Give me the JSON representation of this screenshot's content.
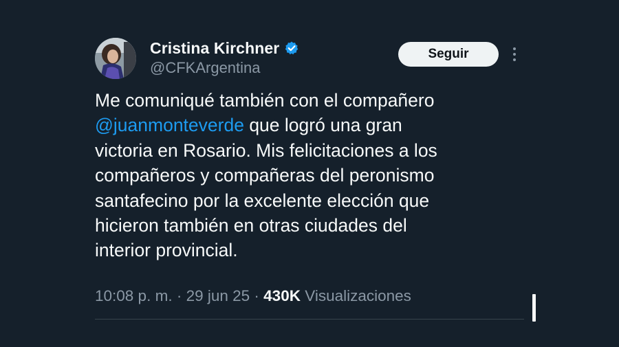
{
  "author": {
    "display_name": "Cristina Kirchner",
    "handle": "@CFKArgentina",
    "verified_icon": "verified-badge-icon",
    "avatar_icon": "profile-photo"
  },
  "actions": {
    "follow_label": "Seguir",
    "more_icon": "more-options-icon"
  },
  "tweet": {
    "line1": "Me comuniqué también con el compañero",
    "mention": "@juanmonteverde",
    "line2_rest": " que logró una gran",
    "line3": "victoria en Rosario. Mis felicitaciones a los",
    "line4": "compañeros y compañeras del peronismo",
    "line5": "santafecino por la excelente elección que",
    "line6": "hicieron también en otras ciudades del",
    "line7": "interior provincial."
  },
  "meta": {
    "time": "10:08 p. m.",
    "separator": " · ",
    "date": "29 jun 25",
    "views_count": "430K",
    "views_label": "Visualizaciones"
  },
  "colors": {
    "background": "#15202b",
    "text": "#f7f9f9",
    "secondary": "#8b98a5",
    "link": "#1d9bf0",
    "verified": "#1d9bf0"
  }
}
